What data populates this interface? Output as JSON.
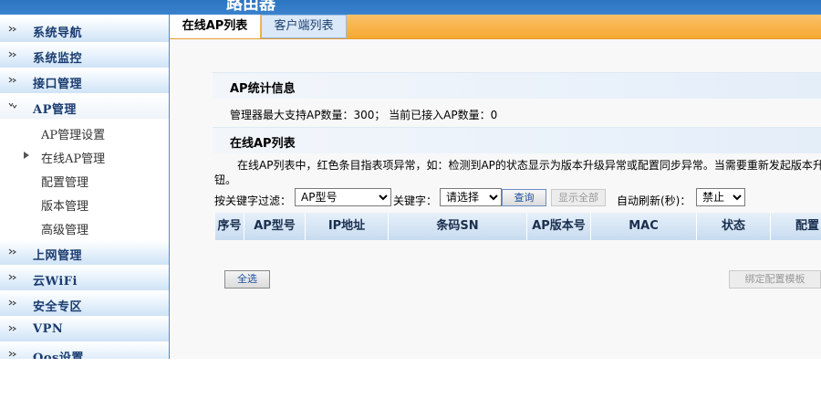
{
  "app": {
    "title": "路由器"
  },
  "sidebar": {
    "groups": [
      {
        "label": "系统导航"
      },
      {
        "label": "系统监控"
      },
      {
        "label": "接口管理"
      },
      {
        "label": "AP管理"
      },
      {
        "label": "上网管理"
      },
      {
        "label": "云WiFi"
      },
      {
        "label": "安全专区"
      },
      {
        "label": "VPN"
      },
      {
        "label": "Qos设置"
      }
    ],
    "ap_subitems": [
      {
        "label": "AP管理设置"
      },
      {
        "label": "在线AP管理"
      },
      {
        "label": "配置管理"
      },
      {
        "label": "版本管理"
      },
      {
        "label": "高级管理"
      }
    ]
  },
  "tabs": [
    {
      "label": "在线AP列表",
      "active": true
    },
    {
      "label": "客户端列表",
      "active": false
    }
  ],
  "stats": {
    "heading": "AP统计信息",
    "text": "管理器最大支持AP数量：300； 当前已接入AP数量：0"
  },
  "list": {
    "heading": "在线AP列表",
    "note_line1": "在线AP列表中，红色条目指表项异常，如：检测到AP的状态显示为版本升级异常或配置同步异常。当需要重新发起版本升",
    "note_line2": "钮。"
  },
  "filter": {
    "filter_label": "按关键字过滤：",
    "type_value": "AP型号",
    "keyword_label": "关键字：",
    "keyword_value": "请选择",
    "query_button": "查询",
    "show_all_button": "显示全部",
    "refresh_label": "自动刷新(秒)：",
    "refresh_value": "禁止"
  },
  "table": {
    "columns": [
      "序号",
      "AP型号",
      "IP地址",
      "条码SN",
      "AP版本号",
      "MAC",
      "状态",
      "配置"
    ]
  },
  "actions": {
    "select_all": "全选",
    "bind_template": "绑定配置模板"
  },
  "colors": {
    "nav_text": "#1a3c70",
    "tab_bar": "#f6a930",
    "header_blue": "#3a82cd"
  }
}
